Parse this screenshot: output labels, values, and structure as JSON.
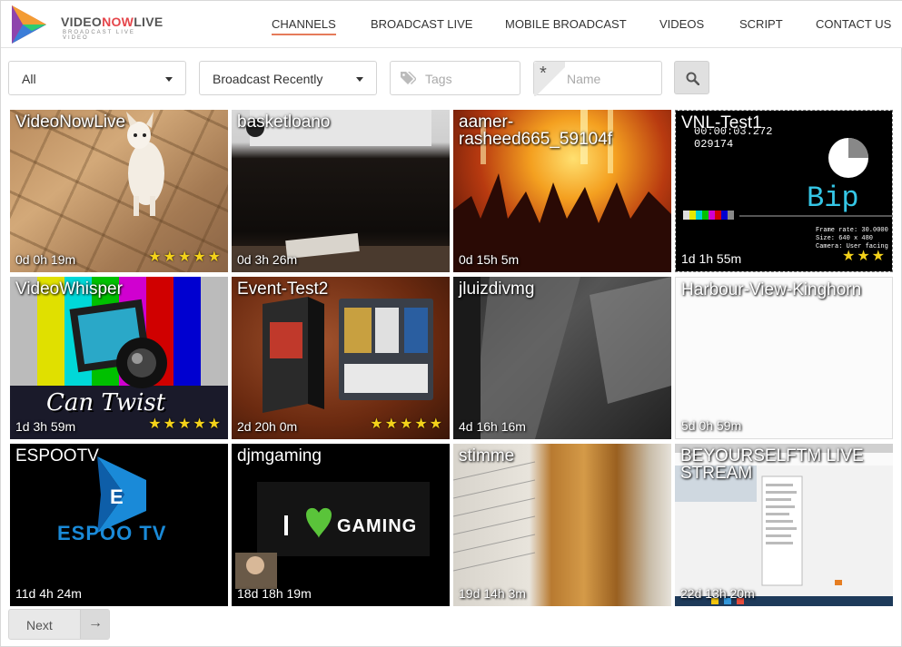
{
  "brand": {
    "name_part1": "VIDEO",
    "name_part2": "NOW",
    "name_part3": "LIVE",
    "tagline": "BROADCAST LIVE VIDEO"
  },
  "nav": {
    "items": [
      {
        "label": "CHANNELS"
      },
      {
        "label": "BROADCAST LIVE"
      },
      {
        "label": "MOBILE BROADCAST"
      },
      {
        "label": "VIDEOS"
      },
      {
        "label": "SCRIPT"
      },
      {
        "label": "CONTACT US"
      }
    ]
  },
  "filters": {
    "category_value": "All",
    "sort_value": "Broadcast Recently",
    "tags_placeholder": "Tags",
    "name_placeholder": "Name",
    "name_marker": "*"
  },
  "channels": [
    {
      "title": "VideoNowLive",
      "time": "0d 0h 19m",
      "stars": "★★★★★"
    },
    {
      "title": "basketloano",
      "time": "0d 3h 26m",
      "stars": ""
    },
    {
      "title": "aamer-rasheed665_59104f",
      "time": "0d 15h 5m",
      "stars": ""
    },
    {
      "title": "VNL-Test1",
      "time": "1d 1h 55m",
      "stars": "★★★"
    },
    {
      "title": "VideoWhisper",
      "time": "1d 3h 59m",
      "stars": "★★★★★"
    },
    {
      "title": "Event-Test2",
      "time": "2d 20h 0m",
      "stars": "★★★★★"
    },
    {
      "title": "jluizdivmg",
      "time": "4d 16h 16m",
      "stars": ""
    },
    {
      "title": "Harbour-View-Kinghorn",
      "time": "5d 0h 59m",
      "stars": ""
    },
    {
      "title": "ESPOOTV",
      "time": "11d 4h 24m",
      "stars": ""
    },
    {
      "title": "djmgaming",
      "time": "18d 18h 19m",
      "stars": ""
    },
    {
      "title": "stimme",
      "time": "19d 14h 3m",
      "stars": ""
    },
    {
      "title": "BEYOURSELFTM LIVE STREAM",
      "time": "22d 13h 20m",
      "stars": ""
    }
  ],
  "thumb_text": {
    "vnl_counter": "00:00:03.272\n029174",
    "vnl_bip": "Bip",
    "vnl_info": "Frame rate: 30.0000\nSize: 640 x 480\nCamera: User facing",
    "vw_caption": "Can Twist",
    "espoo_logo": "ESPOO TV",
    "gaming_text": "GAMING"
  },
  "pager": {
    "next_label": "Next",
    "next_arrow": "→"
  },
  "colors": {
    "accent_underline": "#e57b5a",
    "brand_red": "#e5464b",
    "star_yellow": "#f4d21a"
  }
}
